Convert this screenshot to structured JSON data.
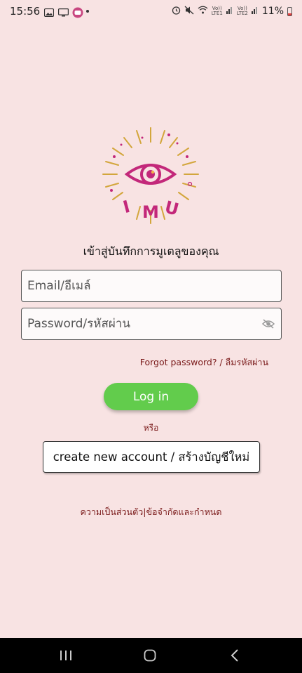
{
  "status_bar": {
    "time": "15:56",
    "battery": "11%",
    "sim1": "Vo))\nLTE1",
    "sim2": "Vo))\nLTE2"
  },
  "login": {
    "heading": "เข้าสู่บันทึกการมูเตลูของคุณ",
    "email_placeholder": "Email/อีเมล์",
    "password_placeholder": "Password/รหัสผ่าน",
    "forgot_label": "Forgot password? / ลืมรหัสผ่าน",
    "login_label": "Log in",
    "or_label": "หรือ",
    "create_label": "create new account / สร้างบัญชีใหม่",
    "privacy_label": "ความเป็นส่วนตัว",
    "separator": "|",
    "terms_label": "ข้อจำกัดและกำหนด"
  },
  "colors": {
    "background": "#f8e3e3",
    "login_button": "#62cc4c",
    "link": "#7a1a1a",
    "logo_primary": "#c3287a",
    "logo_rays": "#d3a63c"
  },
  "logo": {
    "letters": [
      "I",
      "M",
      "U"
    ]
  },
  "nav": {
    "icons": [
      "recent-apps-icon",
      "home-icon",
      "back-icon"
    ]
  }
}
